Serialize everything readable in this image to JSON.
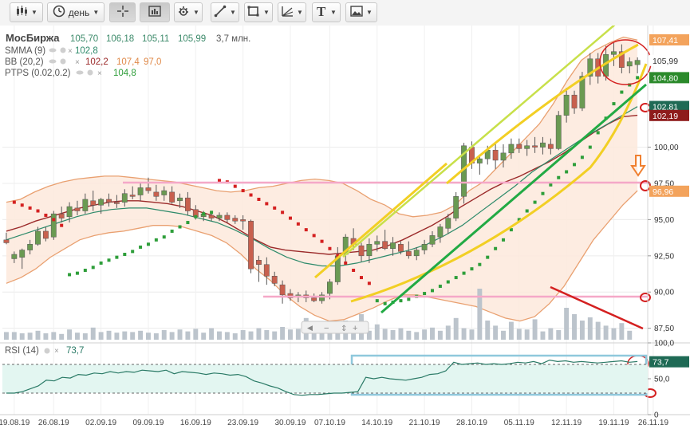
{
  "toolbar": {
    "period_label": "день"
  },
  "legend": {
    "instrument": "МосБиржа",
    "ohlc": [
      "105,70",
      "106,18",
      "105,11",
      "105,99"
    ],
    "volume": "3,7 млн.",
    "smma": {
      "name": "SMMA (9)",
      "value": "102,8"
    },
    "bb": {
      "name": "BB (20,2)",
      "values": [
        "102,2",
        "107,4",
        "97,0"
      ]
    },
    "ptps": {
      "name": "PTPS (0.02,0.2)",
      "value": "104,8"
    },
    "rsi": {
      "name": "RSI (14)",
      "value": "73,7"
    }
  },
  "price_badges": {
    "upper_band": "107,41",
    "last": "105,99",
    "sar": "104,80",
    "smma": "102,81",
    "middle_band": "102,19",
    "lower_band": "96,96",
    "rsi": "73,7"
  },
  "colors": {
    "up": "#6a9a52",
    "down": "#c8604e",
    "bands": "#e9a070",
    "bb_middle": "#9b2a2a",
    "smma": "#2d8a6a",
    "sar": "#2e9e3a",
    "rsi_line": "#2a7a66",
    "annotation_yellow": "#f2cf24",
    "annotation_green": "#22aa44",
    "annotation_pink": "#f5a8c8",
    "annotation_red": "#d42020"
  },
  "chart_data": {
    "type": "candlestick",
    "y_axis_ticks": [
      "100,00",
      "97,50",
      "95,00",
      "92,50",
      "90,00",
      "87,50"
    ],
    "ylim": [
      86.6,
      108.4
    ],
    "x_tick_labels": [
      "19.08.19",
      "26.08.19",
      "02.09.19",
      "09.09.19",
      "16.09.19",
      "23.09.19",
      "30.09.19",
      "07.10.19",
      "14.10.19",
      "21.10.19",
      "28.10.19",
      "05.11.19",
      "12.11.19",
      "19.11.19",
      "26.11.19"
    ],
    "candles": [
      [
        19.0,
        93.6,
        94.1,
        93.3,
        93.4
      ],
      [
        19.6,
        92.3,
        92.8,
        92.0,
        92.6
      ],
      [
        20.2,
        92.4,
        93.0,
        91.6,
        92.9
      ],
      [
        20.8,
        92.9,
        93.6,
        92.6,
        93.3
      ],
      [
        21.4,
        93.3,
        94.5,
        93.2,
        94.2
      ],
      [
        22.0,
        94.2,
        94.5,
        93.5,
        93.7
      ],
      [
        22.6,
        93.8,
        95.6,
        93.6,
        95.4
      ],
      [
        23.2,
        95.4,
        95.9,
        94.8,
        95.1
      ],
      [
        23.8,
        95.2,
        96.2,
        94.8,
        95.9
      ],
      [
        24.4,
        95.8,
        96.3,
        95.3,
        95.6
      ],
      [
        25.0,
        95.6,
        96.8,
        95.4,
        96.4
      ],
      [
        25.6,
        96.3,
        97.0,
        95.6,
        96.0
      ],
      [
        26.2,
        96.0,
        96.5,
        95.4,
        96.4
      ],
      [
        26.8,
        96.4,
        96.8,
        95.9,
        96.2
      ],
      [
        27.4,
        96.2,
        96.7,
        95.8,
        96.1
      ],
      [
        28.0,
        96.2,
        97.1,
        95.9,
        96.8
      ],
      [
        28.6,
        96.7,
        97.3,
        96.4,
        96.6
      ],
      [
        29.2,
        96.7,
        97.5,
        96.3,
        97.2
      ],
      [
        29.8,
        97.2,
        97.9,
        96.8,
        97.0
      ],
      [
        30.4,
        96.9,
        97.4,
        96.3,
        96.6
      ],
      [
        31.0,
        96.7,
        97.3,
        96.3,
        97.0
      ],
      [
        31.6,
        96.9,
        97.3,
        96.1,
        96.2
      ],
      [
        32.2,
        96.3,
        96.8,
        95.8,
        96.5
      ],
      [
        32.8,
        96.5,
        96.9,
        95.3,
        95.6
      ],
      [
        33.4,
        95.7,
        96.0,
        95.0,
        95.2
      ],
      [
        34.0,
        95.2,
        95.6,
        94.9,
        95.4
      ],
      [
        34.6,
        95.3,
        95.6,
        94.9,
        95.1
      ],
      [
        35.2,
        95.1,
        95.5,
        94.9,
        95.3
      ],
      [
        35.8,
        95.3,
        95.5,
        94.8,
        95.0
      ],
      [
        36.4,
        95.1,
        95.3,
        94.7,
        94.9
      ],
      [
        37.0,
        95.0,
        95.3,
        94.3,
        94.9
      ],
      [
        37.6,
        94.9,
        95.0,
        91.3,
        91.6
      ],
      [
        38.2,
        92.2,
        92.5,
        90.7,
        91.9
      ],
      [
        38.8,
        91.9,
        92.4,
        90.5,
        91.1
      ],
      [
        39.4,
        91.1,
        91.4,
        90.4,
        90.6
      ],
      [
        40.0,
        90.5,
        90.8,
        89.2,
        89.8
      ],
      [
        40.6,
        89.9,
        90.2,
        89.4,
        89.6
      ],
      [
        41.2,
        89.7,
        90.0,
        89.3,
        89.8
      ],
      [
        41.8,
        89.8,
        90.1,
        89.3,
        89.6
      ],
      [
        42.4,
        89.6,
        89.9,
        89.3,
        89.4
      ],
      [
        43.0,
        89.4,
        90.0,
        89.2,
        89.8
      ],
      [
        43.6,
        89.9,
        90.9,
        89.5,
        90.7
      ],
      [
        44.2,
        90.7,
        93.1,
        90.5,
        92.5
      ],
      [
        44.8,
        92.6,
        94.0,
        91.9,
        93.8
      ],
      [
        45.4,
        93.7,
        94.4,
        92.9,
        93.3
      ],
      [
        46.0,
        93.2,
        93.4,
        92.1,
        92.5
      ],
      [
        46.6,
        92.5,
        93.7,
        92.0,
        93.3
      ],
      [
        47.2,
        93.3,
        93.9,
        92.8,
        93.5
      ],
      [
        47.8,
        93.5,
        94.3,
        92.9,
        93.0
      ],
      [
        48.4,
        93.0,
        93.8,
        92.5,
        93.4
      ],
      [
        49.0,
        93.3,
        93.5,
        92.6,
        92.8
      ],
      [
        49.6,
        92.8,
        93.5,
        92.3,
        92.5
      ],
      [
        50.2,
        92.5,
        93.1,
        92.2,
        92.9
      ],
      [
        50.8,
        92.9,
        93.6,
        92.6,
        93.3
      ],
      [
        51.4,
        93.3,
        94.2,
        93.1,
        93.9
      ],
      [
        52.0,
        93.8,
        94.7,
        93.4,
        94.5
      ],
      [
        52.6,
        94.4,
        95.4,
        94.0,
        95.1
      ],
      [
        53.2,
        95.1,
        96.9,
        94.9,
        96.6
      ],
      [
        53.8,
        96.6,
        100.3,
        96.1,
        100.1
      ],
      [
        54.4,
        100.0,
        100.4,
        98.5,
        98.9
      ],
      [
        55.0,
        98.9,
        99.5,
        98.1,
        99.2
      ],
      [
        55.6,
        99.2,
        100.1,
        98.8,
        99.8
      ],
      [
        56.2,
        99.8,
        100.2,
        98.5,
        99.1
      ],
      [
        56.8,
        99.1,
        100.2,
        98.6,
        99.6
      ],
      [
        57.4,
        99.6,
        100.6,
        99.2,
        100.2
      ],
      [
        58.0,
        100.2,
        100.6,
        99.6,
        99.9
      ],
      [
        58.6,
        99.9,
        100.5,
        99.4,
        100.1
      ],
      [
        59.2,
        100.1,
        100.7,
        99.6,
        100.0
      ],
      [
        59.8,
        100.0,
        100.7,
        99.5,
        100.3
      ],
      [
        60.4,
        100.2,
        100.6,
        99.5,
        99.9
      ],
      [
        61.0,
        99.9,
        102.5,
        99.8,
        102.2
      ],
      [
        61.6,
        102.2,
        104.1,
        101.7,
        103.6
      ],
      [
        62.2,
        103.6,
        103.9,
        102.3,
        102.7
      ],
      [
        62.8,
        102.7,
        105.2,
        102.5,
        104.9
      ],
      [
        63.4,
        104.9,
        106.5,
        104.3,
        106.1
      ],
      [
        64.0,
        106.1,
        106.5,
        104.4,
        104.9
      ],
      [
        64.6,
        104.9,
        107.0,
        104.6,
        106.4
      ],
      [
        65.2,
        106.4,
        107.2,
        105.6,
        106.6
      ],
      [
        65.8,
        106.6,
        107.1,
        105.1,
        105.5
      ],
      [
        66.4,
        105.6,
        106.2,
        105.1,
        105.9
      ],
      [
        67.0,
        105.7,
        106.2,
        105.1,
        106.0
      ]
    ],
    "upper_band": [
      96.2,
      96.4,
      96.9,
      97.3,
      97.6,
      97.8,
      97.9,
      98.0,
      98.0,
      97.9,
      97.8,
      97.7,
      97.6,
      97.4,
      97.2,
      97.0,
      96.9,
      97.0,
      97.2,
      97.3,
      97.5,
      97.7,
      97.8,
      97.7,
      97.5,
      97.0,
      96.4,
      96.0,
      95.4,
      95.2,
      95.3,
      95.5,
      96.0,
      97.0,
      97.6,
      98.6,
      99.6,
      100.6,
      101.6,
      103.0,
      104.6,
      106.0,
      106.7,
      107.2,
      107.6,
      107.4
    ],
    "middle_band": [
      94.2,
      94.5,
      94.9,
      95.2,
      95.5,
      95.8,
      96.0,
      96.2,
      96.3,
      96.3,
      96.2,
      96.1,
      95.9,
      95.6,
      95.3,
      94.8,
      94.2,
      93.6,
      93.1,
      92.9,
      92.8,
      92.7,
      92.6,
      92.7,
      92.8,
      92.9,
      93.2,
      93.6,
      94.1,
      94.6,
      95.2,
      95.9,
      96.5,
      97.1,
      97.6,
      98.0,
      98.5,
      99.0,
      99.6,
      100.3,
      101.0,
      101.6,
      102.1,
      102.2
    ],
    "lower_band": [
      90.6,
      91.0,
      91.6,
      92.4,
      93.0,
      93.6,
      93.9,
      94.1,
      94.2,
      94.4,
      94.6,
      94.6,
      94.5,
      94.2,
      93.9,
      93.4,
      92.6,
      91.6,
      90.8,
      89.8,
      89.0,
      88.4,
      88.0,
      88.1,
      88.5,
      88.9,
      89.4,
      89.8,
      89.8,
      89.6,
      89.4,
      89.2,
      89.0,
      88.6,
      88.2,
      88.0,
      88.3,
      89.2,
      90.4,
      92.0,
      93.6,
      94.8,
      96.0,
      97.0
    ],
    "smma": [
      93.6,
      94.0,
      94.4,
      94.8,
      95.2,
      95.5,
      95.7,
      95.8,
      95.8,
      95.6,
      95.4,
      95.1,
      94.8,
      94.3,
      93.7,
      93.0,
      92.4,
      92.0,
      91.8,
      91.8,
      92.0,
      92.3,
      92.6,
      92.9,
      93.3,
      93.9,
      94.6,
      95.5,
      96.4,
      97.3,
      98.3,
      99.1,
      99.9,
      100.7,
      101.4,
      102.1,
      102.8
    ],
    "sar": [
      [
        1,
        96.2
      ],
      [
        2,
        96.0
      ],
      [
        3,
        95.8
      ],
      [
        4,
        95.6
      ],
      [
        5,
        95.3
      ],
      [
        6,
        95.0
      ],
      [
        7,
        94.6
      ],
      [
        8,
        91.2
      ],
      [
        9,
        91.3
      ],
      [
        10,
        91.5
      ],
      [
        11,
        91.7
      ],
      [
        12,
        92.0
      ],
      [
        13,
        92.2
      ],
      [
        14,
        92.4
      ],
      [
        15,
        92.6
      ],
      [
        16,
        92.8
      ],
      [
        17,
        93.1
      ],
      [
        18,
        93.3
      ],
      [
        19,
        93.6
      ],
      [
        20,
        93.8
      ],
      [
        21,
        94.2
      ],
      [
        22,
        94.5
      ],
      [
        23,
        94.8
      ],
      [
        24,
        95.2
      ],
      [
        25,
        95.4
      ],
      [
        26,
        95.5
      ],
      [
        27,
        97.7
      ],
      [
        28,
        97.6
      ],
      [
        29,
        97.3
      ],
      [
        30,
        97.0
      ],
      [
        31,
        96.7
      ],
      [
        32,
        96.4
      ],
      [
        33,
        96.1
      ],
      [
        34,
        95.8
      ],
      [
        35,
        95.5
      ],
      [
        36,
        95.1
      ],
      [
        37,
        94.7
      ],
      [
        38,
        94.3
      ],
      [
        39,
        93.9
      ],
      [
        40,
        93.5
      ],
      [
        41,
        93.0
      ],
      [
        42,
        92.5
      ],
      [
        43,
        92.0
      ],
      [
        44,
        91.5
      ],
      [
        45,
        91.0
      ],
      [
        46,
        90.6
      ],
      [
        47,
        89.4
      ],
      [
        48,
        89.2
      ],
      [
        49,
        89.3
      ],
      [
        50,
        89.4
      ],
      [
        51,
        89.5
      ],
      [
        52,
        89.7
      ],
      [
        53,
        89.9
      ],
      [
        54,
        90.1
      ],
      [
        55,
        90.4
      ],
      [
        56,
        90.7
      ],
      [
        57,
        91.0
      ],
      [
        58,
        91.3
      ],
      [
        59,
        91.6
      ],
      [
        60,
        91.9
      ],
      [
        61,
        92.4
      ],
      [
        62,
        93.0
      ],
      [
        63,
        93.6
      ],
      [
        64,
        94.3
      ],
      [
        65,
        95.0
      ],
      [
        66,
        95.6
      ],
      [
        67,
        96.2
      ],
      [
        68,
        96.8
      ],
      [
        69,
        97.4
      ],
      [
        70,
        97.9
      ],
      [
        71,
        98.3
      ],
      [
        72,
        98.8
      ],
      [
        73,
        99.3
      ],
      [
        74,
        100.0
      ],
      [
        75,
        101.0
      ],
      [
        76,
        102.0
      ],
      [
        77,
        103.0
      ],
      [
        78,
        103.8
      ],
      [
        79,
        104.3
      ],
      [
        80,
        104.8
      ]
    ],
    "volume": [
      12,
      12,
      10,
      11,
      14,
      10,
      12,
      9,
      16,
      11,
      10,
      19,
      12,
      14,
      11,
      13,
      12,
      14,
      11,
      10,
      15,
      12,
      16,
      13,
      17,
      11,
      18,
      13,
      12,
      10,
      15,
      13,
      18,
      15,
      13,
      20,
      16,
      17,
      34,
      22,
      18,
      16,
      21,
      30,
      17,
      40,
      14,
      24,
      17,
      15,
      18,
      14,
      12,
      16,
      19,
      14,
      22,
      34,
      18,
      16,
      80,
      30,
      22,
      14,
      28,
      17,
      16,
      32,
      13,
      18,
      15,
      50,
      40,
      30,
      35,
      28,
      22,
      18,
      26,
      14
    ],
    "rsi": {
      "ylim": [
        0,
        100
      ],
      "ticks": [
        "100,0",
        "50,0",
        "0"
      ],
      "levels": [
        70,
        30
      ],
      "values": [
        30,
        30,
        32,
        36,
        40,
        48,
        47,
        52,
        51,
        56,
        55,
        58,
        57,
        60,
        58,
        60,
        59,
        62,
        61,
        60,
        62,
        57,
        60,
        59,
        58,
        56,
        58,
        57,
        55,
        56,
        53,
        47,
        44,
        40,
        37,
        32,
        28,
        27,
        28,
        28,
        29,
        30,
        30,
        31,
        32,
        52,
        50,
        52,
        50,
        49,
        48,
        50,
        52,
        56,
        57,
        61,
        73,
        70,
        71,
        72,
        70,
        71,
        70,
        71,
        73,
        72,
        74,
        71,
        76,
        74,
        75,
        73,
        74,
        73,
        72,
        73,
        74,
        75,
        73,
        74
      ]
    }
  }
}
